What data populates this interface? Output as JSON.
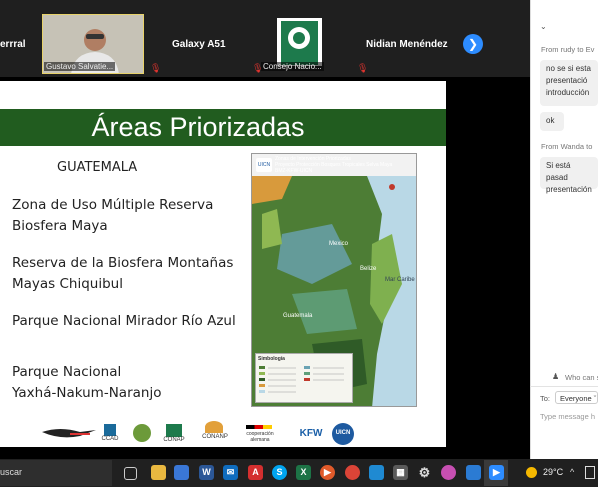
{
  "participants": [
    {
      "name": "errral"
    },
    {
      "name": "Gustavo Salvatie..."
    },
    {
      "name": "Galaxy A51"
    },
    {
      "name": "Consejo Nacio..."
    },
    {
      "name": "Nidian Menéndez"
    }
  ],
  "slide": {
    "title": "Áreas Priorizadas",
    "country": "GUATEMALA",
    "areas": [
      "Zona de Uso Múltiple Reserva",
      "Biosfera Maya",
      "Reserva de la Biosfera Montañas",
      "Mayas Chiquibul",
      "Parque Nacional Mirador Río Azul",
      "Parque Nacional",
      "Yaxhá-Nakum-Naranjo"
    ],
    "map": {
      "title_lines": [
        "Zonas de Intervención Priorizadas",
        "Proyecto Protección Bosques Tropicales Selva Maya",
        "BMZ-KFW-UICN"
      ],
      "labels": [
        "Belize",
        "Guatemala",
        "Mar Caribe",
        "Mexico"
      ],
      "legend_title": "Simbología"
    },
    "logos": [
      "CCAD",
      "CONAP",
      "CONANP",
      "cooperación alemana",
      "KFW",
      "UICN"
    ]
  },
  "chat": {
    "messages": [
      {
        "meta": "From rudy to Ev",
        "lines": [
          "no se si esta",
          "presentació",
          "introducción"
        ]
      },
      {
        "meta": "",
        "lines": [
          "ok"
        ]
      },
      {
        "meta": "From Wanda to",
        "lines": [
          "Si está pasad",
          "presentación"
        ]
      }
    ],
    "who_can_see": "Who can s",
    "to_label": "To:",
    "recipient": "Everyone",
    "input_placeholder": "Type message h"
  },
  "taskbar": {
    "search_text": "uscar",
    "weather": "29°C",
    "apps": [
      "task-view",
      "explorer",
      "store",
      "word",
      "mail",
      "pdf",
      "skype",
      "excel",
      "music",
      "chrome",
      "edge",
      "calculator",
      "settings",
      "paint",
      "files",
      "zoom"
    ]
  },
  "colors": {
    "title_bar": "#215c1f",
    "accent": "#2d8cff",
    "taskbar": "#202020"
  }
}
